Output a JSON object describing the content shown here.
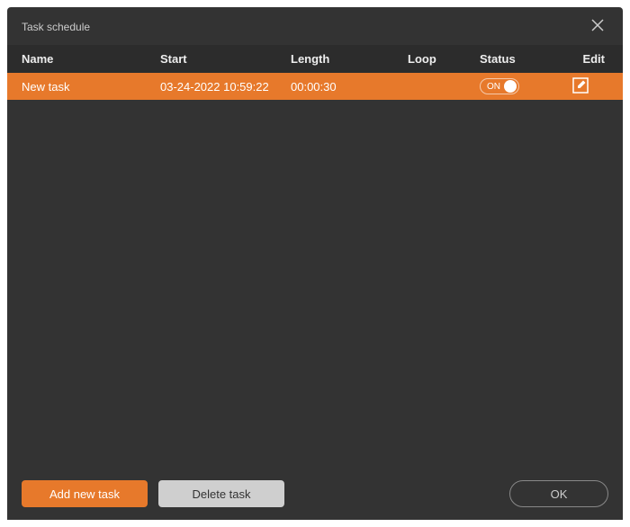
{
  "window": {
    "title": "Task schedule"
  },
  "columns": {
    "name": "Name",
    "start": "Start",
    "length": "Length",
    "loop": "Loop",
    "status": "Status",
    "edit": "Edit"
  },
  "tasks": [
    {
      "name": "New task",
      "start": "03-24-2022 10:59:22",
      "length": "00:00:30",
      "loop": "",
      "status_on": true,
      "status_label": "ON"
    }
  ],
  "footer": {
    "add_label": "Add new task",
    "delete_label": "Delete task",
    "ok_label": "OK"
  }
}
